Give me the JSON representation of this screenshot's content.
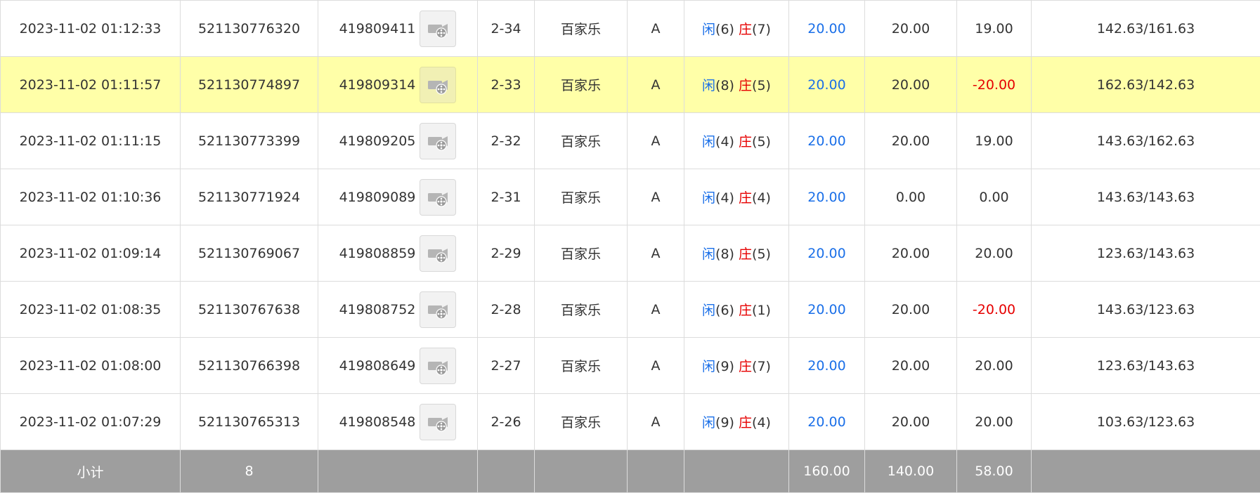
{
  "colors": {
    "highlight_row": "#ffffa8",
    "positive_blue": "#1a6fe8",
    "negative_red": "#e60000",
    "subtotal_bg": "#9e9e9e"
  },
  "icons": {
    "replay": "film-reel-icon"
  },
  "labels": {
    "player": "闲",
    "banker": "庄"
  },
  "rows": [
    {
      "time": "2023-11-02 01:12:33",
      "order_id": "521130776320",
      "txn_id": "419809411",
      "round": "2-34",
      "game": "百家乐",
      "table": "A",
      "player_score": "(6)",
      "banker_score": "(7)",
      "bet": "20.00",
      "valid_bet": "20.00",
      "win_loss": "19.00",
      "balance": "142.63/161.63"
    },
    {
      "time": "2023-11-02 01:11:57",
      "order_id": "521130774897",
      "txn_id": "419809314",
      "round": "2-33",
      "game": "百家乐",
      "table": "A",
      "player_score": "(8)",
      "banker_score": "(5)",
      "bet": "20.00",
      "valid_bet": "20.00",
      "win_loss": "-20.00",
      "balance": "162.63/142.63",
      "highlight": true
    },
    {
      "time": "2023-11-02 01:11:15",
      "order_id": "521130773399",
      "txn_id": "419809205",
      "round": "2-32",
      "game": "百家乐",
      "table": "A",
      "player_score": "(4)",
      "banker_score": "(5)",
      "bet": "20.00",
      "valid_bet": "20.00",
      "win_loss": "19.00",
      "balance": "143.63/162.63"
    },
    {
      "time": "2023-11-02 01:10:36",
      "order_id": "521130771924",
      "txn_id": "419809089",
      "round": "2-31",
      "game": "百家乐",
      "table": "A",
      "player_score": "(4)",
      "banker_score": "(4)",
      "bet": "20.00",
      "valid_bet": "0.00",
      "win_loss": "0.00",
      "balance": "143.63/143.63"
    },
    {
      "time": "2023-11-02 01:09:14",
      "order_id": "521130769067",
      "txn_id": "419808859",
      "round": "2-29",
      "game": "百家乐",
      "table": "A",
      "player_score": "(8)",
      "banker_score": "(5)",
      "bet": "20.00",
      "valid_bet": "20.00",
      "win_loss": "20.00",
      "balance": "123.63/143.63"
    },
    {
      "time": "2023-11-02 01:08:35",
      "order_id": "521130767638",
      "txn_id": "419808752",
      "round": "2-28",
      "game": "百家乐",
      "table": "A",
      "player_score": "(6)",
      "banker_score": "(1)",
      "bet": "20.00",
      "valid_bet": "20.00",
      "win_loss": "-20.00",
      "balance": "143.63/123.63"
    },
    {
      "time": "2023-11-02 01:08:00",
      "order_id": "521130766398",
      "txn_id": "419808649",
      "round": "2-27",
      "game": "百家乐",
      "table": "A",
      "player_score": "(9)",
      "banker_score": "(7)",
      "bet": "20.00",
      "valid_bet": "20.00",
      "win_loss": "20.00",
      "balance": "123.63/143.63"
    },
    {
      "time": "2023-11-02 01:07:29",
      "order_id": "521130765313",
      "txn_id": "419808548",
      "round": "2-26",
      "game": "百家乐",
      "table": "A",
      "player_score": "(9)",
      "banker_score": "(4)",
      "bet": "20.00",
      "valid_bet": "20.00",
      "win_loss": "20.00",
      "balance": "103.63/123.63"
    }
  ],
  "subtotal": {
    "label": "小计",
    "count": "8",
    "bet_total": "160.00",
    "valid_total": "140.00",
    "win_total": "58.00"
  }
}
